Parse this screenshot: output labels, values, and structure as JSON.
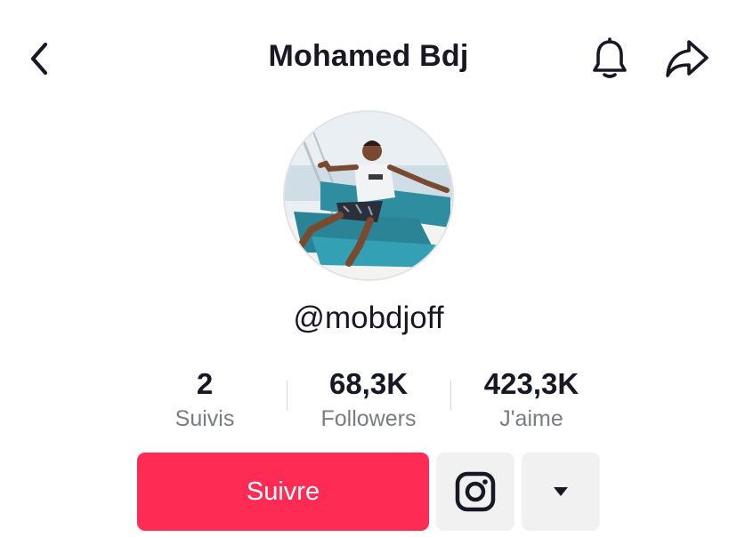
{
  "header": {
    "title": "Mohamed Bdj",
    "back_icon": "chevron-left-icon",
    "bell_icon": "bell-icon",
    "share_icon": "share-arrow-icon"
  },
  "profile": {
    "username": "@mobdjoff",
    "avatar": "profile-photo"
  },
  "stats": [
    {
      "value": "2",
      "label": "Suivis"
    },
    {
      "value": "68,3K",
      "label": "Followers"
    },
    {
      "value": "423,3K",
      "label": "J'aime"
    }
  ],
  "actions": {
    "follow_label": "Suivre",
    "instagram_icon": "instagram-icon",
    "more_icon": "caret-down-icon"
  },
  "colors": {
    "accent": "#fe2c55",
    "secondary_button_bg": "#f1f1f2",
    "muted_text": "#7a7c85"
  }
}
